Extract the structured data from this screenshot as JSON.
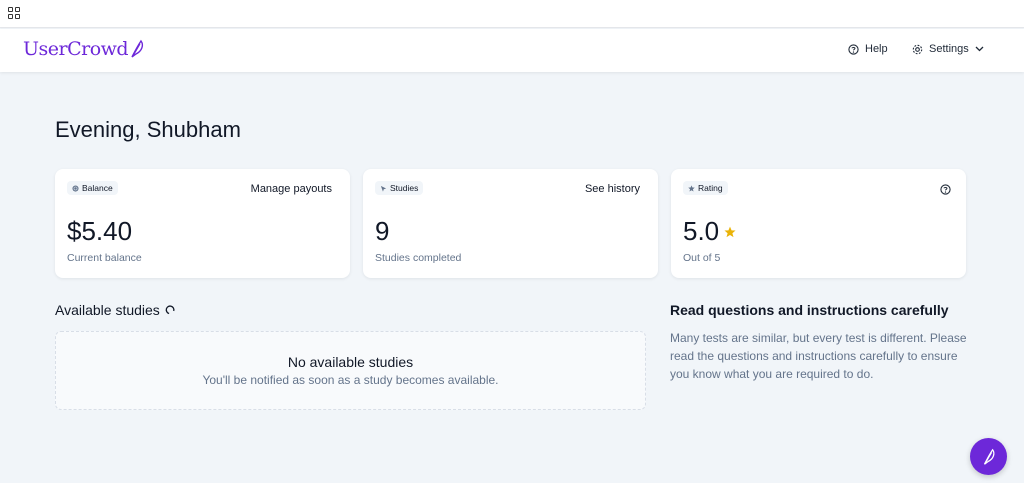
{
  "header": {
    "logo_text": "UserCrowd",
    "help_label": "Help",
    "settings_label": "Settings"
  },
  "greeting": "Evening, Shubham",
  "cards": {
    "balance": {
      "tag": "Balance",
      "action": "Manage payouts",
      "value": "$5.40",
      "caption": "Current balance"
    },
    "studies": {
      "tag": "Studies",
      "action": "See history",
      "value": "9",
      "caption": "Studies completed"
    },
    "rating": {
      "tag": "Rating",
      "value": "5.0",
      "caption": "Out of 5"
    }
  },
  "available": {
    "title": "Available studies",
    "empty_title": "No available studies",
    "empty_sub": "You'll be notified as soon as a study becomes available."
  },
  "tips": {
    "title": "Read questions and instructions carefully",
    "body": "Many tests are similar, but every test is different. Please read the questions and instructions carefully to ensure you know what you are required to do."
  },
  "colors": {
    "brand": "#6d28d9",
    "star": "#eab308",
    "background": "#f1f5f9"
  },
  "icons": {
    "apps": "apps-grid-icon",
    "logo": "feather-icon",
    "help": "question-circle-icon",
    "settings": "gear-icon",
    "dropdown": "chevron-down-icon",
    "balance": "coin-icon",
    "studies": "pointer-icon",
    "rating": "star-icon",
    "refresh": "refresh-icon",
    "fab": "feather-icon"
  }
}
